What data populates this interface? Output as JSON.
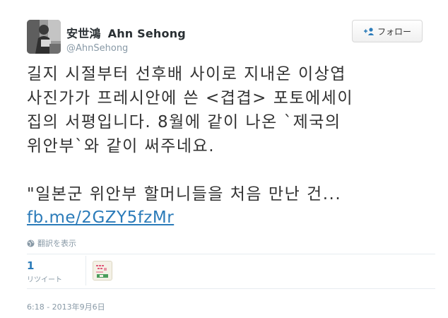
{
  "author": {
    "name_cjk": "安世鴻",
    "name_latin": "Ahn Sehong",
    "handle": "@AhnSehong"
  },
  "follow_button": {
    "label": "フォロー",
    "icon": "add-user-icon"
  },
  "tweet": {
    "text": "길지 시절부터 선후배 사이로 지내온 이상엽\n사진가가 프레시안에 쓴 <겹겹> 포토에세이\n집의 서평입니다. 8월에 같이 나온 `제국의\n위안부`와 같이 써주네요.\n\n\"일본군 위안부 할머니들을 처음 만난 건...",
    "link": "fb.me/2GZY5fzMr"
  },
  "translate": {
    "label": "翻訳を表示",
    "icon": "globe-icon"
  },
  "stats": {
    "retweet_count": "1",
    "retweet_label": "リツイート"
  },
  "retweeter_avatar": {
    "icon": "book-cover-avatar",
    "colors": {
      "accent": "#e05a7a",
      "green": "#4a9d5b"
    }
  },
  "timestamp": "6:18 - 2013年9月6日",
  "colors": {
    "link": "#2b7bb9",
    "muted": "#8899a6",
    "text": "#333333",
    "divider": "#e6ecf0"
  }
}
